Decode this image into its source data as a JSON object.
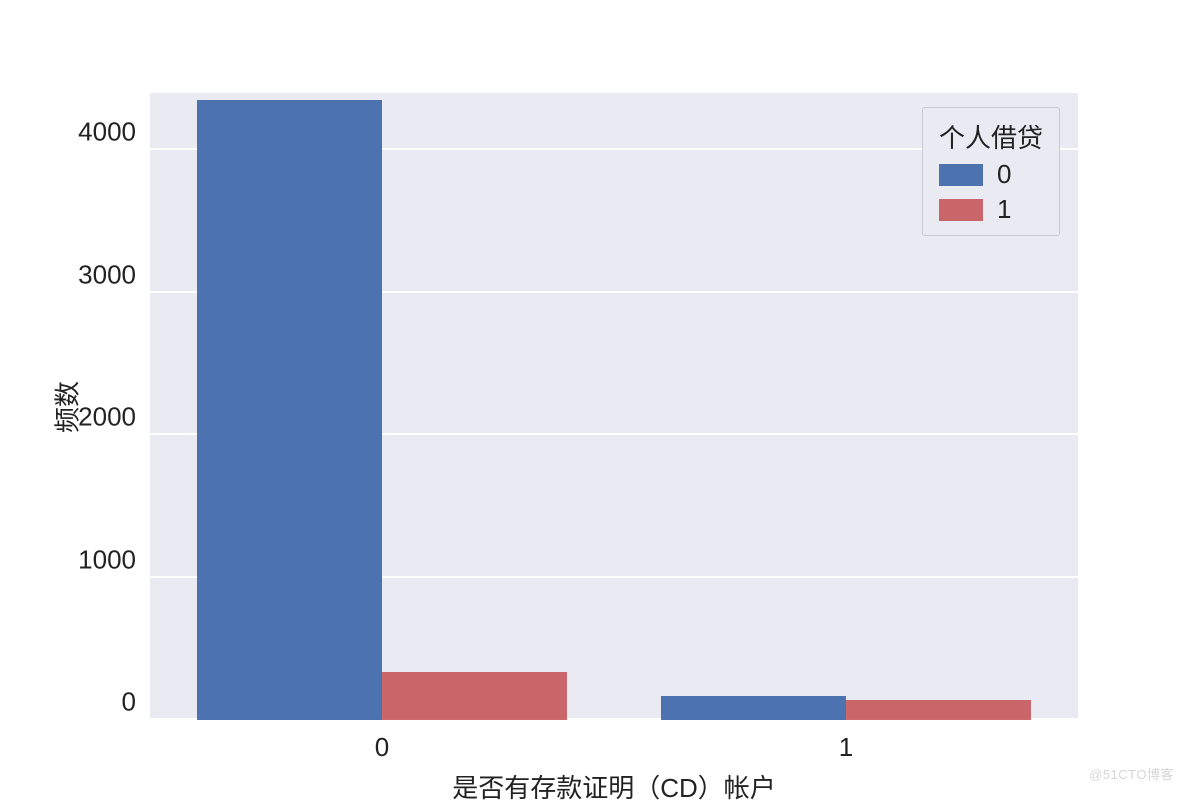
{
  "chart_data": {
    "type": "bar",
    "categories": [
      "0",
      "1"
    ],
    "series": [
      {
        "name": "0",
        "values": [
          4350,
          170
        ],
        "color": "#4c72b0"
      },
      {
        "name": "1",
        "values": [
          340,
          140
        ],
        "color": "#c44e52"
      }
    ],
    "xlabel": "是否有存款证明（CD）帐户",
    "ylabel": "频数",
    "legend_title": "个人借贷",
    "ylim": [
      0,
      4400
    ],
    "yticks": [
      0,
      1000,
      2000,
      3000,
      4000
    ],
    "xticks": [
      "0",
      "1"
    ]
  },
  "yticks": {
    "t0": "0",
    "t1": "1000",
    "t2": "2000",
    "t3": "3000",
    "t4": "4000"
  },
  "xticks": {
    "c0": "0",
    "c1": "1"
  },
  "labels": {
    "xlabel": "是否有存款证明（CD）帐户",
    "ylabel": "频数",
    "legend_title": "个人借贷",
    "legend0": "0",
    "legend1": "1"
  },
  "watermark": "@51CTO博客"
}
